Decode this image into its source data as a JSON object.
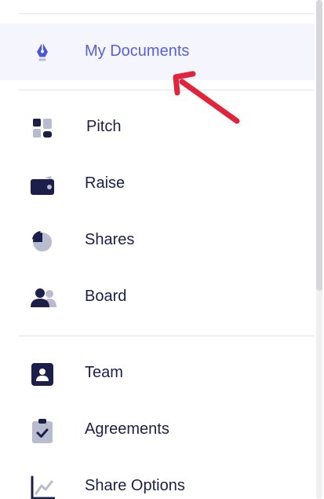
{
  "sidebar": {
    "items": [
      {
        "label": "My Documents",
        "icon": "pen-nib-icon",
        "active": true
      },
      {
        "label": "Pitch",
        "icon": "dashboard-tiles-icon"
      },
      {
        "label": "Raise",
        "icon": "wallet-icon"
      },
      {
        "label": "Shares",
        "icon": "pie-chart-icon"
      },
      {
        "label": "Board",
        "icon": "users-icon"
      },
      {
        "label": "Team",
        "icon": "id-badge-icon"
      },
      {
        "label": "Agreements",
        "icon": "clipboard-check-icon"
      },
      {
        "label": "Share Options",
        "icon": "line-chart-icon"
      }
    ]
  },
  "colors": {
    "active_text": "#5a5fe0",
    "active_bg": "#f5f5fd",
    "text": "#1b1f4a",
    "icon_dark": "#1b1f4a",
    "icon_light": "#b9bccf",
    "annotation_arrow": "#e0243c"
  }
}
